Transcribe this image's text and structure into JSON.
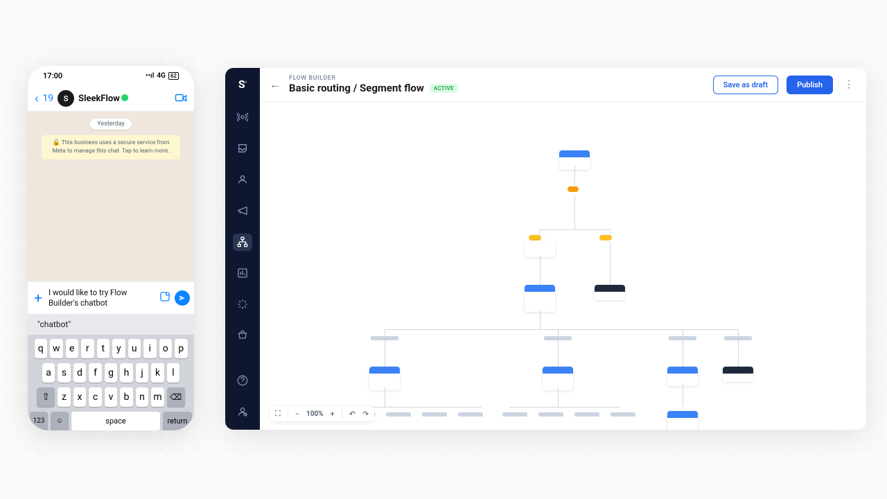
{
  "phone": {
    "time": "17:00",
    "signal": "4G",
    "battery": "62",
    "back_count": "19",
    "contact_initial": "S",
    "contact_name": "SleekFlow",
    "day_label": "Yesterday",
    "security_notice": "This business uses a secure service from Meta to manage this chat. Tap to learn more.",
    "draft_message": "I would like to try Flow Builder's chatbot",
    "suggestion": "\"chatbot\"",
    "keyboard": {
      "row1": [
        "q",
        "w",
        "e",
        "r",
        "t",
        "y",
        "u",
        "i",
        "o",
        "p"
      ],
      "row2": [
        "a",
        "s",
        "d",
        "f",
        "g",
        "h",
        "j",
        "k",
        "l"
      ],
      "row3": [
        "z",
        "x",
        "c",
        "v",
        "b",
        "n",
        "m"
      ],
      "fn_123": "123",
      "space": "space",
      "return": "return"
    }
  },
  "builder": {
    "eyebrow": "FLOW BUILDER",
    "title": "Basic routing / Segment flow",
    "status_badge": "ACTIVE",
    "save_draft": "Save as draft",
    "publish": "Publish",
    "zoom": "100%",
    "nodes": {
      "trigger": "",
      "condition_left": "",
      "condition_right": "",
      "action_left": "",
      "action_right": ""
    }
  }
}
